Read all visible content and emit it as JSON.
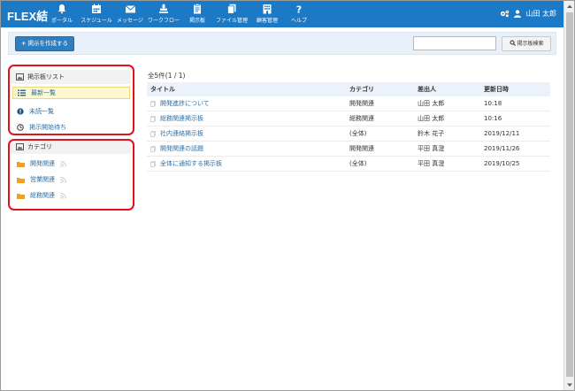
{
  "app": {
    "brand": "FLEX結"
  },
  "nav": [
    {
      "label": "ポータル",
      "icon": "bell-icon"
    },
    {
      "label": "スケジュール",
      "icon": "calendar-icon"
    },
    {
      "label": "メッセージ",
      "icon": "envelope-icon"
    },
    {
      "label": "ワークフロー",
      "icon": "stamp-icon"
    },
    {
      "label": "掲示板",
      "icon": "clipboard-icon"
    },
    {
      "label": "ファイル管理",
      "icon": "files-icon"
    },
    {
      "label": "顧客管理",
      "icon": "building-icon"
    },
    {
      "label": "ヘルプ",
      "icon": "question-icon"
    }
  ],
  "user": {
    "name": "山田 太郎",
    "settings_icon": "gears-icon",
    "user_icon": "user-icon"
  },
  "toolbar": {
    "create_label": "掲示を作成する",
    "search_value": "",
    "search_button": "掲示板検索"
  },
  "sidebar": {
    "list_heading": "掲示板リスト",
    "list_items": [
      {
        "label": "最新一覧",
        "icon": "list-icon",
        "active": true
      },
      {
        "label": "未読一覧",
        "icon": "exclamation-icon",
        "active": false
      },
      {
        "label": "掲示開始待ち",
        "icon": "clock-icon",
        "active": false
      }
    ],
    "category_heading": "カテゴリ",
    "category_items": [
      {
        "label": "開発関連",
        "icon": "folder-icon",
        "feed": "rss-icon"
      },
      {
        "label": "営業関連",
        "icon": "folder-icon",
        "feed": "rss-icon"
      },
      {
        "label": "総務関連",
        "icon": "folder-icon",
        "feed": "rss-icon"
      }
    ]
  },
  "main": {
    "count": "全5件(1 / 1)",
    "columns": [
      "タイトル",
      "カテゴリ",
      "差出人",
      "更新日時"
    ],
    "rows": [
      {
        "title": "開発進捗について",
        "category": "開発関連",
        "sender": "山田 太郎",
        "updated": "10:18"
      },
      {
        "title": "総務関連掲示板",
        "category": "総務関連",
        "sender": "山田 太郎",
        "updated": "10:16"
      },
      {
        "title": "社内連絡掲示板",
        "category": "(全体)",
        "sender": "鈴木 花子",
        "updated": "2019/12/11"
      },
      {
        "title": "開発関連の話題",
        "category": "開発関連",
        "sender": "平田 真澄",
        "updated": "2019/11/26"
      },
      {
        "title": "全体に通知する掲示板",
        "category": "(全体)",
        "sender": "平田 真澄",
        "updated": "2019/10/25"
      }
    ]
  },
  "colors": {
    "navbar": "#1b79c5",
    "link": "#2b6ea5",
    "highlight": "#e2121a",
    "active_bg": "#fdf8d0"
  }
}
